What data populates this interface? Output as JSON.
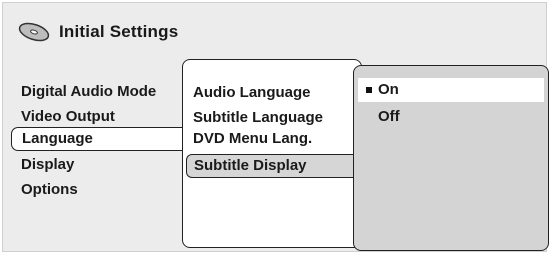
{
  "header": {
    "title": "Initial Settings",
    "icon": "disc-icon"
  },
  "left_menu": {
    "items": [
      {
        "label": "Digital Audio Mode",
        "selected": false
      },
      {
        "label": "Video Output",
        "selected": false
      },
      {
        "label": "Language",
        "selected": true
      },
      {
        "label": "Display",
        "selected": false
      },
      {
        "label": "Options",
        "selected": false
      }
    ]
  },
  "mid_menu": {
    "items": [
      {
        "label": "Audio Language",
        "selected": false
      },
      {
        "label": "Subtitle Language",
        "selected": false
      },
      {
        "label": "DVD Menu Lang.",
        "selected": false
      },
      {
        "label": "Subtitle Display",
        "selected": true
      }
    ]
  },
  "options": {
    "items": [
      {
        "label": "On",
        "selected": true
      },
      {
        "label": "Off",
        "selected": false
      }
    ]
  },
  "colors": {
    "background": "#ececec",
    "panel": "#ffffff",
    "highlight": "#d6d6d6",
    "options_panel": "#d4d4d4",
    "border": "#222222"
  }
}
